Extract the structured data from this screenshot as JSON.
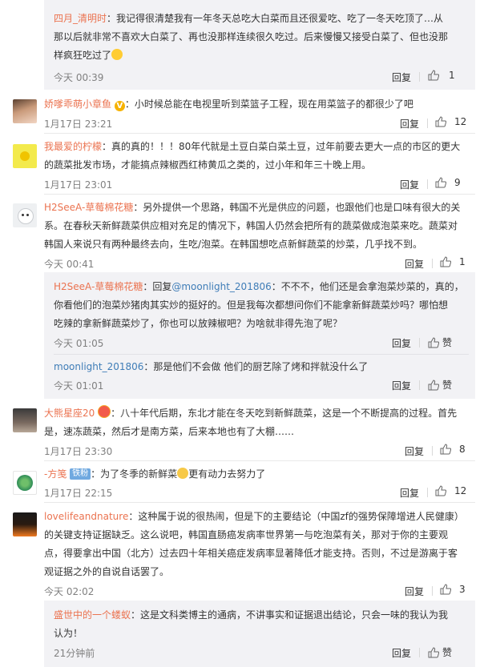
{
  "labels": {
    "reply": "回复",
    "like": "赞"
  },
  "colors": {
    "name": "#eb7350",
    "link": "#3f7db7",
    "subBg": "#f2f2f5",
    "time": "#808080"
  },
  "comments": [
    {
      "name": "四月_清明时",
      "lines": [
        "：我记得很清楚我有一年冬天总吃大白菜而且还很爱吃、吃了一冬天吃顶了…从",
        "那以后就非常不喜欢大白菜了、再也没那样连续很久吃过。后来慢慢又接受白菜了、但也没那",
        "样疯狂吃过了"
      ],
      "time": "今天 00:39",
      "likes": "1"
    },
    {
      "name": "娇嗲乖萌小章鱼",
      "lines": [
        "：小时候总能在电视里听到菜篮子工程，现在用菜篮子的都很少了吧"
      ],
      "time": "1月17日 23:21",
      "likes": "12"
    },
    {
      "name": "我最爱的柠檬",
      "lines": [
        "：真的真的！！！80年代就是土豆白菜白菜土豆，过年前要去更大一点的市区的更大",
        "的蔬菜批发市场，才能搞点辣椒西红柿黄瓜之类的，过小年和年三十晚上用。"
      ],
      "time": "1月17日 23:01",
      "likes": "9"
    },
    {
      "name": "H2SeeA-草莓棉花糖",
      "lines": [
        "：另外提供一个思路，韩国不光是供应的问题，也跟他们也是口味有很大的关",
        "系。在春秋天新鲜蔬菜供应相对充足的情况下，韩国人仍然会把所有的蔬菜做成泡菜来吃。蔬菜对",
        "韩国人来说只有两种最终去向，生吃/泡菜。在韩国想吃点新鲜蔬菜的炒菜，几乎找不到。"
      ],
      "time": "今天 00:41",
      "likes": "1"
    },
    {
      "name": "H2SeeA-草莓棉花糖",
      "reply_prefix": "：回复",
      "mention": "@moonlight_201806",
      "lines": [
        "：不不不，他们还是会拿泡菜炒菜的，真的，",
        "你看他们的泡菜炒猪肉其实炒的挺好的。但是我每次都想问你们不能拿新鲜蔬菜炒吗？哪怕想",
        "吃辣的拿新鲜蔬菜炒了，你也可以放辣椒吧？为啥就非得先泡了呢？"
      ],
      "time": "今天 01:05"
    },
    {
      "name": "moonlight_201806",
      "lines": [
        "：那是他们不会做 他们的厨艺除了烤和拌就没什么了"
      ],
      "time": "今天 01:01"
    },
    {
      "name": "大熊星座20",
      "lines": [
        "：八十年代后期，东北才能在冬天吃到新鲜蔬菜，这是一个不断提高的过程。首先",
        "是，速冻蔬菜，然后才是南方菜，后来本地也有了大棚……"
      ],
      "time": "1月17日 23:30",
      "likes": "8"
    },
    {
      "name": "-方笺",
      "badge": "铁粉",
      "text_a": "：为了冬季的新鲜菜",
      "text_b": "更有动力去努力了",
      "time": "1月17日 22:15",
      "likes": "12"
    },
    {
      "name": "lovelifeandnature",
      "lines": [
        "：这种属于说的很热闹，但是下的主要结论（中国zf的强势保障增进人民健康）",
        "的关键支持证据缺乏。这么说吧，韩国直肠癌发病率世界第一与吃泡菜有关，那对于你的主要观",
        "点，得要拿出中国（北方）过去四十年相关癌症发病率显著降低才能支持。否则，不过是游离于客",
        "观证据之外的自说自话罢了。"
      ],
      "time": "今天 02:02",
      "likes": "3"
    },
    {
      "name": "盛世中的一个蝼蚁",
      "lines": [
        "：这是文科类博主的通病，不讲事实和证据退出结论，只会一味的我认为我",
        "认为！"
      ],
      "time": "21分钟前"
    }
  ]
}
